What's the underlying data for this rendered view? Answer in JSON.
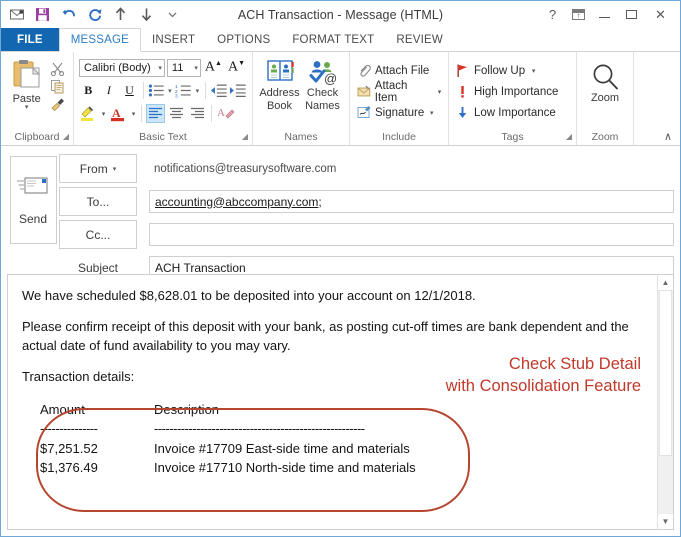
{
  "window": {
    "title": "ACH Transaction - Message (HTML)",
    "quick_access": [
      {
        "name": "envelope-icon",
        "label": "Message"
      },
      {
        "name": "save-icon",
        "label": "Save"
      },
      {
        "name": "undo-icon",
        "label": "Undo"
      },
      {
        "name": "redo-icon",
        "label": "Redo"
      },
      {
        "name": "previous-item-icon",
        "label": "Previous Item"
      },
      {
        "name": "next-item-icon",
        "label": "Next Item"
      },
      {
        "name": "customize-qat-icon",
        "label": "Customize Quick Access Toolbar"
      }
    ],
    "controls": {
      "help": "?",
      "ribbon_display": "Ribbon Display Options",
      "minimize": "Minimize",
      "maximize": "Maximize",
      "close": "✕"
    }
  },
  "tabs": [
    {
      "label": "FILE",
      "state": "file"
    },
    {
      "label": "MESSAGE",
      "state": "active"
    },
    {
      "label": "INSERT",
      "state": "normal"
    },
    {
      "label": "OPTIONS",
      "state": "normal"
    },
    {
      "label": "FORMAT TEXT",
      "state": "normal"
    },
    {
      "label": "REVIEW",
      "state": "normal"
    }
  ],
  "ribbon": {
    "collapse_label": "∧",
    "groups": {
      "clipboard": {
        "label": "Clipboard",
        "paste_label": "Paste",
        "paste_caret": "▾",
        "cut_label": "Cut",
        "copy_label": "Copy",
        "format_painter_label": "Format Painter",
        "launcher": "⤵"
      },
      "basic_text": {
        "label": "Basic Text",
        "font_name": "Calibri (Body)",
        "font_size": "11",
        "grow_font": "A",
        "shrink_font": "A",
        "bold": "B",
        "italic": "I",
        "underline": "U",
        "bullets": "Bullets",
        "numbering": "Numbering",
        "decrease_indent": "Decrease Indent",
        "increase_indent": "Increase Indent",
        "highlight": "Text Highlight Color",
        "font_color": "Font Color",
        "align_left": "Align Left",
        "align_center": "Center",
        "align_right": "Align Right",
        "clear_formatting": "Clear All Formatting",
        "launcher": "⤵"
      },
      "names": {
        "label": "Names",
        "address_book": "Address\nBook",
        "address_book_line1": "Address",
        "address_book_line2": "Book",
        "check_names_line1": "Check",
        "check_names_line2": "Names"
      },
      "include": {
        "label": "Include",
        "items": [
          {
            "label": "Attach File",
            "icon": "paperclip-icon",
            "caret": ""
          },
          {
            "label": "Attach Item",
            "icon": "attach-item-icon",
            "caret": "▾"
          },
          {
            "label": "Signature",
            "icon": "signature-icon",
            "caret": "▾"
          }
        ]
      },
      "tags": {
        "label": "Tags",
        "launcher": "⤵",
        "items": [
          {
            "label": "Follow Up",
            "icon": "flag-icon",
            "caret": "▾"
          },
          {
            "label": "High Importance",
            "icon": "exclamation-icon",
            "caret": ""
          },
          {
            "label": "Low Importance",
            "icon": "down-arrow-icon",
            "caret": ""
          }
        ]
      },
      "zoom": {
        "label": "Zoom",
        "button_label": "Zoom"
      }
    }
  },
  "compose": {
    "send_label": "Send",
    "from": {
      "button_label": "From",
      "caret": "▾",
      "value": "notifications@treasurysoftware.com"
    },
    "to": {
      "button_label": "To...",
      "value": "accounting@abccompany.com",
      "separator": ";"
    },
    "cc": {
      "button_label": "Cc...",
      "value": ""
    },
    "subject": {
      "label": "Subject",
      "value": "ACH Transaction"
    }
  },
  "body": {
    "paragraph1": "We have scheduled $8,628.01 to be deposited into your account on 12/1/2018.",
    "paragraph2": "Please confirm receipt of this deposit with your bank, as posting cut-off times are bank dependent and the actual date of fund availability to you may vary.",
    "paragraph3": "Transaction details:",
    "annotation_line1": "Check Stub Detail",
    "annotation_line2": "with Consolidation Feature",
    "annotation_color": "#c0392b",
    "oval_color": "#b5462f",
    "table": {
      "headers": [
        "Amount",
        "Description"
      ],
      "divider_amount": "---------------",
      "divider_description": "-------------------------------------------------------",
      "rows": [
        {
          "amount": "$7,251.52",
          "description": "Invoice #17709  East-side time and materials"
        },
        {
          "amount": "$1,376.49",
          "description": "Invoice #17710  North-side time and materials"
        }
      ]
    }
  },
  "scrollbar": {
    "up_arrow": "▲",
    "down_arrow": "▼"
  }
}
